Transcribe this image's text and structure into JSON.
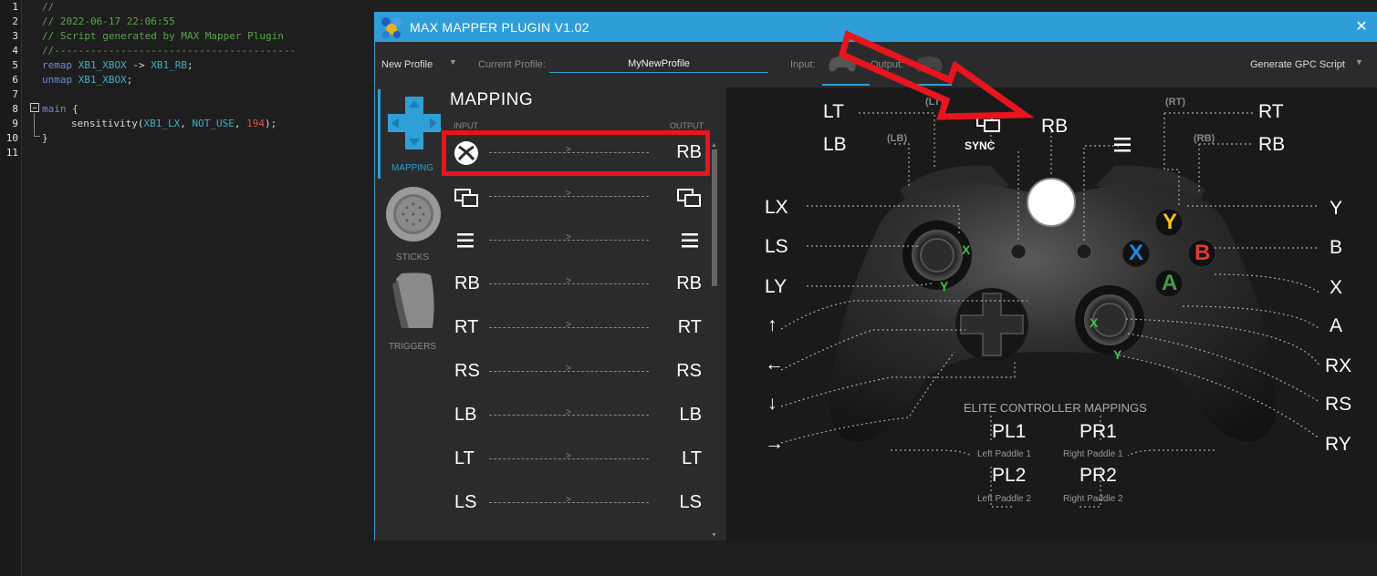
{
  "editor": {
    "line_numbers": [
      "1",
      "2",
      "3",
      "4",
      "5",
      "6",
      "7",
      "8",
      "9",
      "10",
      "11"
    ],
    "comment_1": "//",
    "comment_2": "// 2022-06-17 22:06:55",
    "comment_3": "// Script generated by MAX Mapper Plugin",
    "comment_4": "//----------------------------------------",
    "remap_kw": "remap",
    "remap_src": "XB1_XBOX",
    "remap_arrow": " -> ",
    "remap_dst": "XB1_RB",
    "semi": ";",
    "unmap_kw": "unmap",
    "unmap_src": "XB1_XBOX",
    "main_kw": "main",
    "brace_open": " {",
    "sens_fn": "sensitivity(",
    "sens_arg1": "XB1_LX",
    "sep": ", ",
    "sens_arg2": "NOT_USE",
    "sens_arg3": "194",
    "sens_close": ");",
    "brace_close": "}"
  },
  "window": {
    "title": "MAX MAPPER PLUGIN V1.02",
    "close": "✕"
  },
  "toolbar": {
    "new_profile": "New Profile",
    "current_profile_label": "Current Profile:",
    "current_profile_value": "MyNewProfile",
    "input_label": "Input:",
    "output_label": "Output:",
    "generate": "Generate GPC Script"
  },
  "sidebar": {
    "mapping": "MAPPING",
    "sticks": "STICKS",
    "triggers": "TRIGGERS"
  },
  "mapping": {
    "title": "MAPPING",
    "input_head": "INPUT",
    "output_head": "OUTPUT",
    "rows": [
      {
        "in": "xbox-icon",
        "out": "RB"
      },
      {
        "in": "view-icon",
        "out": "view-icon"
      },
      {
        "in": "menu-icon",
        "out": "menu-icon"
      },
      {
        "in": "RB",
        "out": "RB"
      },
      {
        "in": "RT",
        "out": "RT"
      },
      {
        "in": "RS",
        "out": "RS"
      },
      {
        "in": "LB",
        "out": "LB"
      },
      {
        "in": "LT",
        "out": "LT"
      },
      {
        "in": "LS",
        "out": "LS"
      }
    ],
    "row_texts": {
      "r0_out": "RB",
      "r3_in": "RB",
      "r3_out": "RB",
      "r4_in": "RT",
      "r4_out": "RT",
      "r5_in": "RS",
      "r5_out": "RS",
      "r6_in": "LB",
      "r6_out": "LB",
      "r7_in": "LT",
      "r7_out": "LT",
      "r8_in": "LS",
      "r8_out": "LS"
    }
  },
  "controller": {
    "lt": "LT",
    "lb": "LB",
    "lt_small": "(LT)",
    "lb_small": "(LB)",
    "sync": "SYNC",
    "rb_center": "RB",
    "rt_small": "(RT)",
    "rb_small": "(RB)",
    "rt": "RT",
    "rb": "RB",
    "lx": "LX",
    "ls": "LS",
    "ly": "LY",
    "up": "↑",
    "left": "←",
    "down": "↓",
    "right": "→",
    "y": "Y",
    "b": "B",
    "x": "X",
    "a": "A",
    "rx": "RX",
    "rs": "RS",
    "ry": "RY",
    "stick_x": "X",
    "stick_y": "Y",
    "face_y": "Y",
    "face_b": "B",
    "face_x": "X",
    "face_a": "A",
    "elite_title": "ELITE CONTROLLER MAPPINGS",
    "pl1": "PL1",
    "pr1": "PR1",
    "pl2": "PL2",
    "pr2": "PR2",
    "pl1_sub": "Left Paddle 1",
    "pr1_sub": "Right Paddle 1",
    "pl2_sub": "Left Paddle 2",
    "pr2_sub": "Right Paddle 2"
  },
  "colors": {
    "accent": "#2fa0d6",
    "annotation_red": "#e8141e",
    "face_y": "#f2c21b",
    "face_b": "#e53935",
    "face_x": "#1e88e5",
    "face_a": "#43a047"
  }
}
